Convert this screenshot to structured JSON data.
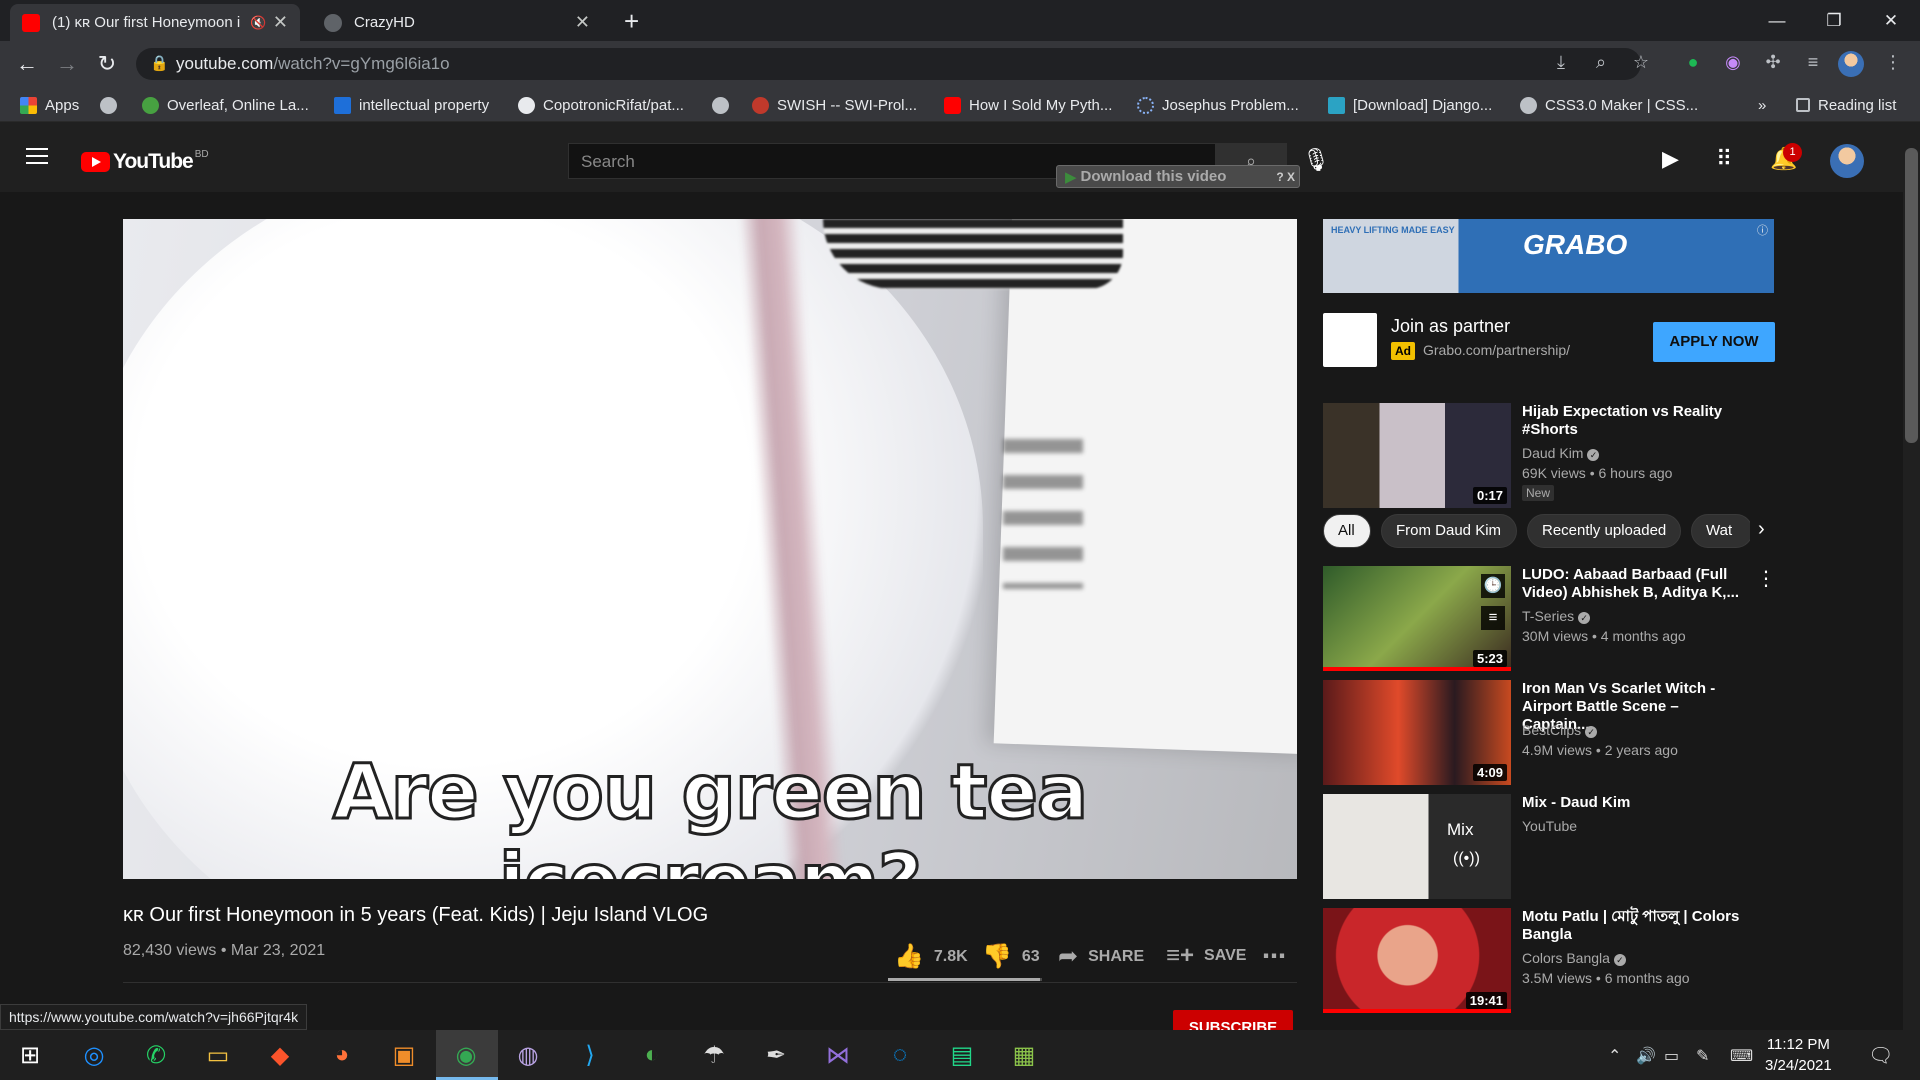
{
  "browser": {
    "tabs": [
      {
        "title": "(1) ᴋʀ Our first Honeymoon i",
        "active": true,
        "icon": "youtube-icon"
      },
      {
        "title": "CrazyHD",
        "active": false,
        "icon": "globe-icon"
      }
    ],
    "url": {
      "host": "youtube.com",
      "path": "/watch?v=gYmg6l6ia1o"
    },
    "bookmarks": [
      "Apps",
      "Overleaf, Online La...",
      "intellectual property",
      "CopotronicRifat/pat...",
      "SWISH -- SWI-Prol...",
      "How I Sold My Pyth...",
      "Josephus Problem...",
      "[Download] Django...",
      "CSS3.0 Maker | CSS..."
    ],
    "reading_list": "Reading list",
    "more": "»"
  },
  "youtube": {
    "logo_word": "YouTube",
    "country": "BD",
    "search_placeholder": "Search",
    "download_bar": "Download this video",
    "download_q": "? X",
    "notifications": "1",
    "subtitle": "Are you green tea icecream?",
    "video": {
      "title": "ᴋʀ Our first Honeymoon in 5 years (Feat. Kids) | Jeju Island VLOG",
      "meta": "82,430 views • Mar 23, 2021",
      "likes": "7.8K",
      "dislikes": "63",
      "share": "SHARE",
      "save": "SAVE",
      "like_ratio": 0.99
    },
    "subscribe": "SUBSCRIBE",
    "status_url": "https://www.youtube.com/watch?v=jh66Pjtqr4k",
    "ad": {
      "banner_brand": "GRABO",
      "banner_slogan": "HEAVY LIFTING MADE EASY",
      "title": "Join as partner",
      "badge": "Ad",
      "url": "Grabo.com/partnership/",
      "button": "APPLY NOW"
    },
    "chips": [
      "All",
      "From Daud Kim",
      "Recently uploaded",
      "Wat"
    ],
    "recommendations": [
      {
        "title": "Hijab Expectation vs Reality #Shorts",
        "channel": "Daud Kim",
        "views": "69K views • 6 hours ago",
        "badge": "New",
        "duration": "0:17"
      },
      {
        "title": "LUDO: Aabaad Barbaad (Full Video) Abhishek B, Aditya K,...",
        "channel": "T-Series",
        "views": "30M views • 4 months ago",
        "duration": "5:23"
      },
      {
        "title": "Iron Man Vs Scarlet Witch - Airport Battle Scene – Captain...",
        "channel": "BestClips",
        "views": "4.9M views • 2 years ago",
        "duration": "4:09"
      },
      {
        "title": "Mix - Daud Kim",
        "channel": "YouTube",
        "mix_label": "Mix"
      },
      {
        "title": "Motu Patlu | মোটু পাতলু | Colors Bangla",
        "channel": "Colors Bangla",
        "views": "3.5M views • 6 months ago",
        "duration": "19:41"
      }
    ]
  },
  "taskbar": {
    "time": "11:12 PM",
    "date": "3/24/2021"
  }
}
